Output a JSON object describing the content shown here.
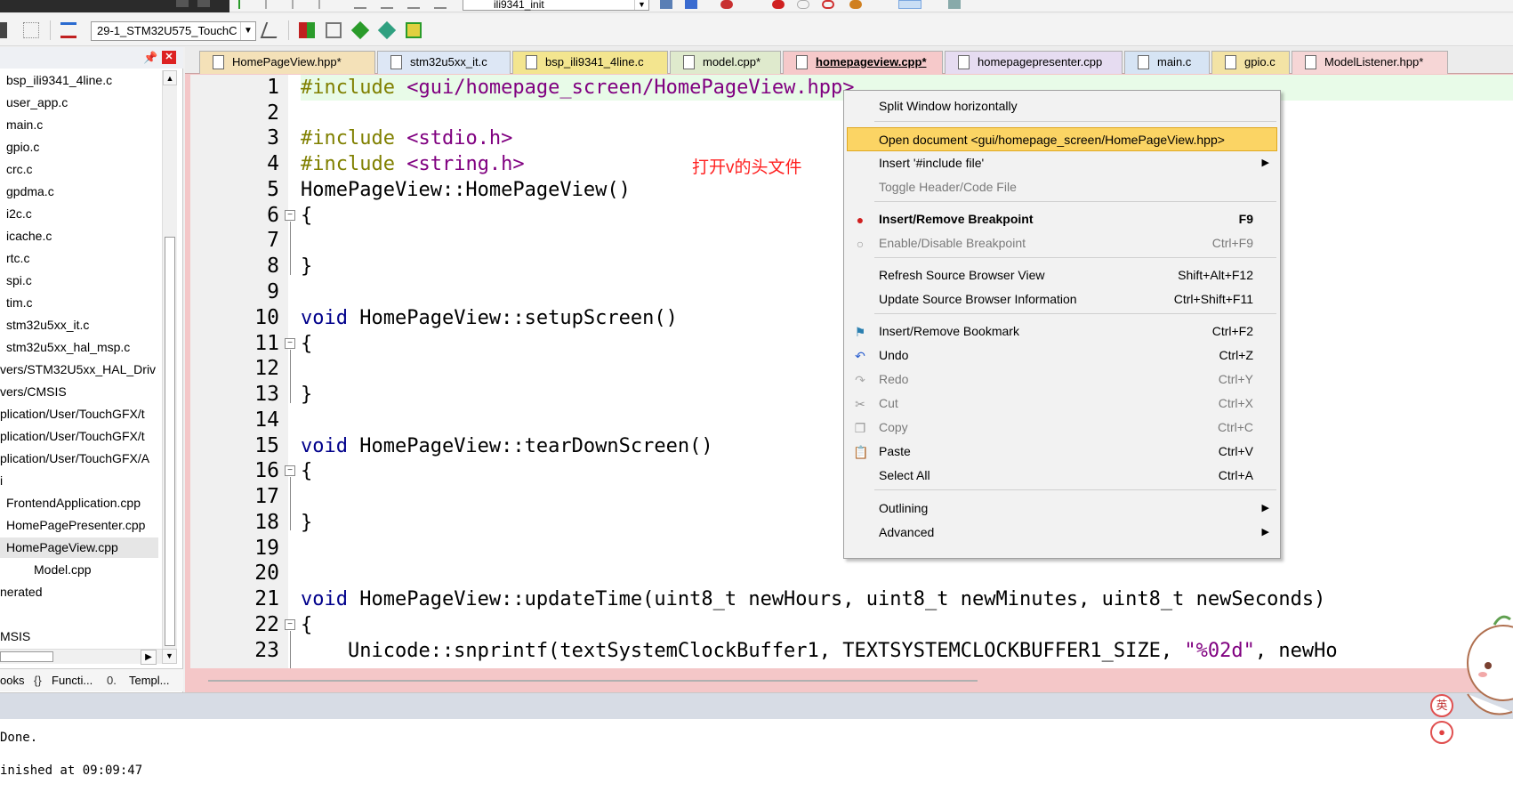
{
  "toolbar": {
    "function_combo": "ili9341_init",
    "target_combo": "29-1_STM32U575_TouchC"
  },
  "project": {
    "items": [
      "bsp_ili9341_4line.c",
      "user_app.c",
      "main.c",
      "gpio.c",
      "crc.c",
      "gpdma.c",
      "i2c.c",
      "icache.c",
      "rtc.c",
      "spi.c",
      "tim.c",
      "stm32u5xx_it.c",
      "stm32u5xx_hal_msp.c",
      "vers/STM32U5xx_HAL_Driv",
      "vers/CMSIS",
      "plication/User/TouchGFX/t",
      "plication/User/TouchGFX/t",
      "plication/User/TouchGFX/A",
      "i",
      "FrontendApplication.cpp",
      "HomePagePresenter.cpp",
      "HomePageView.cpp",
      "Model.cpp",
      "nerated",
      "",
      "MSIS"
    ],
    "bottom_tabs": [
      "ooks",
      "Functi...",
      "Templ..."
    ]
  },
  "tabs": [
    "HomePageView.hpp*",
    "stm32u5xx_it.c",
    "bsp_ili9341_4line.c",
    "model.cpp*",
    "homepageview.cpp*",
    "homepagepresenter.cpp",
    "main.c",
    "gpio.c",
    "ModelListener.hpp*"
  ],
  "code": {
    "line_numbers": [
      "1",
      "2",
      "3",
      "4",
      "5",
      "6",
      "7",
      "8",
      "9",
      "10",
      "11",
      "12",
      "13",
      "14",
      "15",
      "16",
      "17",
      "18",
      "19",
      "20",
      "21",
      "22",
      "23"
    ],
    "l1_pp": "#include ",
    "l1_str": "<gui/homepage_screen/HomePageView.hpp>",
    "l3_pp": "#include ",
    "l3_str": "<stdio.h>",
    "l4_pp": "#include ",
    "l4_str": "<string.h>",
    "l5": "HomePageView::HomePageView()",
    "brace_open": "{",
    "brace_close": "}",
    "l10_kw": "void",
    "l10": " HomePageView::setupScreen()",
    "l15_kw": "void",
    "l15": " HomePageView::tearDownScreen()",
    "l21_kw": "void",
    "l21": " HomePageView::updateTime(uint8_t newHours, uint8_t newMinutes, uint8_t newSeconds)",
    "l23a": "    Unicode::snprintf(textSystemClockBuffer1, TEXTSYSTEMCLOCKBUFFER1_SIZE, ",
    "l23_str": "\"%02d\"",
    "l23b": ", newHo"
  },
  "annotation": "打开v的头文件",
  "output": {
    "line1": "Done.",
    "line2": "inished at 09:09:47"
  },
  "context_menu": {
    "split": "Split Window horizontally",
    "open_doc": "Open document <gui/homepage_screen/HomePageView.hpp>",
    "insert_include": "Insert '#include file'",
    "toggle_header": "Toggle Header/Code File",
    "insert_bp": "Insert/Remove Breakpoint",
    "insert_bp_sc": "F9",
    "enable_bp": "Enable/Disable Breakpoint",
    "enable_bp_sc": "Ctrl+F9",
    "refresh_browser": "Refresh Source Browser View",
    "refresh_browser_sc": "Shift+Alt+F12",
    "update_browser": "Update Source Browser Information",
    "update_browser_sc": "Ctrl+Shift+F11",
    "bookmark": "Insert/Remove Bookmark",
    "bookmark_sc": "Ctrl+F2",
    "undo": "Undo",
    "undo_sc": "Ctrl+Z",
    "redo": "Redo",
    "redo_sc": "Ctrl+Y",
    "cut": "Cut",
    "cut_sc": "Ctrl+X",
    "copy": "Copy",
    "copy_sc": "Ctrl+C",
    "paste": "Paste",
    "paste_sc": "Ctrl+V",
    "select_all": "Select All",
    "select_all_sc": "Ctrl+A",
    "outlining": "Outlining",
    "advanced": "Advanced"
  },
  "ime": {
    "lang": "英"
  },
  "colors": {
    "accent_tab": "#f6c9ca",
    "menu_highlight": "#fbd464",
    "annotation": "#ff2020"
  }
}
